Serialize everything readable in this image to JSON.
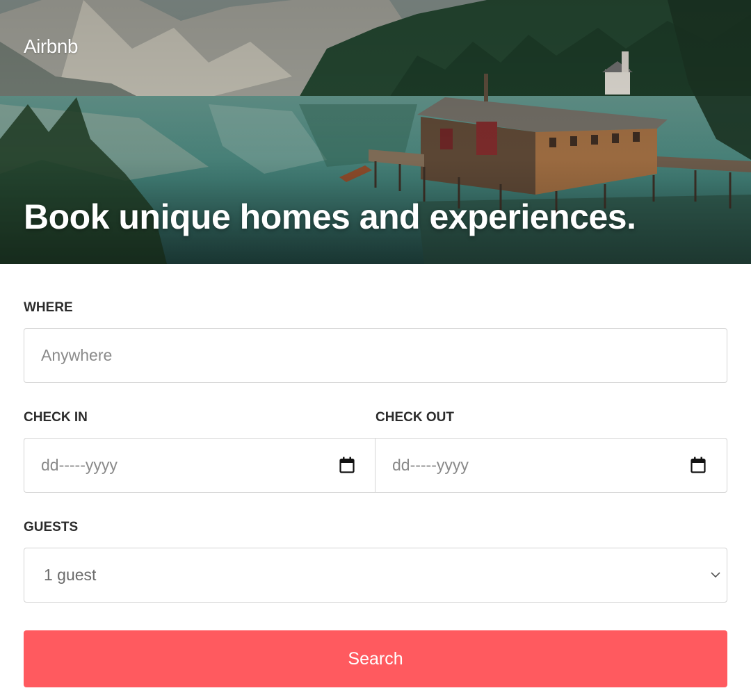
{
  "hero": {
    "logo": "Airbnb",
    "headline": "Book unique homes and experiences."
  },
  "form": {
    "where": {
      "label": "WHERE",
      "placeholder": "Anywhere"
    },
    "check_in": {
      "label": "CHECK IN",
      "placeholder": "dd-----yyyy",
      "icon": "calendar-icon"
    },
    "check_out": {
      "label": "CHECK OUT",
      "placeholder": "dd-----yyyy",
      "icon": "calendar-icon"
    },
    "guests": {
      "label": "GUESTS",
      "selected": "1 guest",
      "icon": "chevron-down-icon"
    },
    "search_label": "Search"
  },
  "colors": {
    "accent": "#ff5a5f",
    "label_text": "#2b2b2b",
    "placeholder_text": "#8a8a8a",
    "field_border": "#d4d4d4"
  }
}
